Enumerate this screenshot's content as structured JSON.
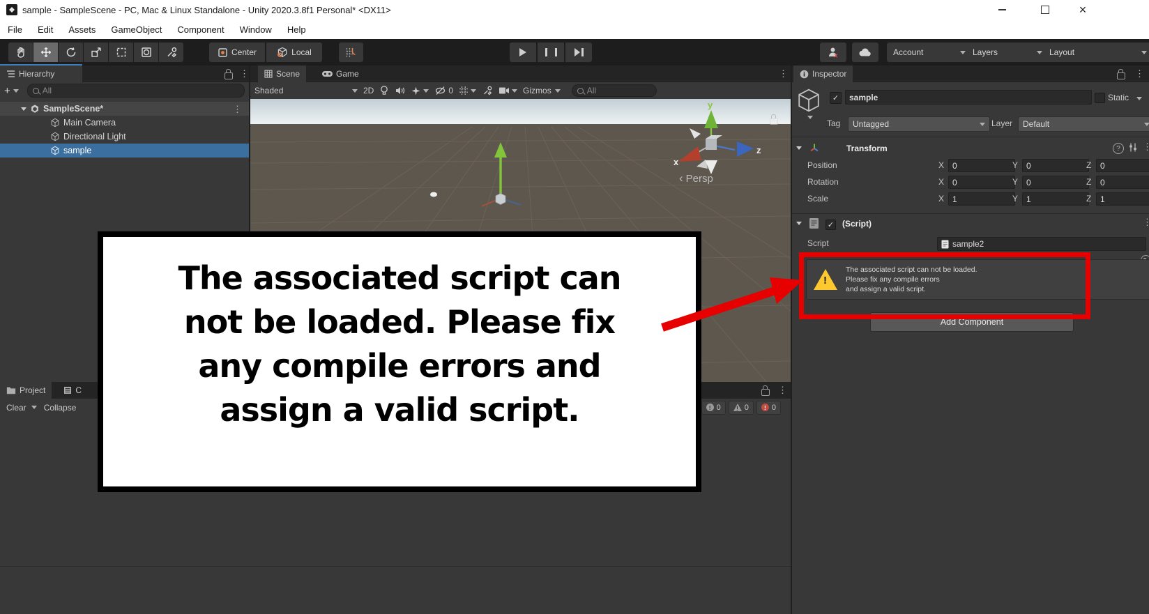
{
  "window": {
    "title": "sample - SampleScene - PC, Mac & Linux Standalone - Unity 2020.3.8f1 Personal* <DX11>"
  },
  "menu": {
    "items": [
      "File",
      "Edit",
      "Assets",
      "GameObject",
      "Component",
      "Window",
      "Help"
    ]
  },
  "toolbar": {
    "center": "Center",
    "local": "Local",
    "account": "Account",
    "layers": "Layers",
    "layout": "Layout"
  },
  "hierarchy": {
    "tab": "Hierarchy",
    "search_placeholder": "All",
    "scene_row": "SampleScene*",
    "children": [
      "Main Camera",
      "Directional Light",
      "sample"
    ]
  },
  "scene": {
    "tab_scene": "Scene",
    "tab_game": "Game",
    "shaded": "Shaded",
    "mode_2d": "2D",
    "hidden_count": "0",
    "gizmos": "Gizmos",
    "search_placeholder": "All",
    "persp": "Persp",
    "axes": {
      "x": "x",
      "y": "y",
      "z": "z"
    }
  },
  "inspector": {
    "tab": "Inspector",
    "object_name": "sample",
    "static_label": "Static",
    "tag_label": "Tag",
    "tag_value": "Untagged",
    "layer_label": "Layer",
    "layer_value": "Default",
    "transform": {
      "title": "Transform",
      "axis_x": "X",
      "axis_y": "Y",
      "axis_z": "Z",
      "rows": [
        {
          "label": "Position",
          "x": "0",
          "y": "0",
          "z": "0"
        },
        {
          "label": "Rotation",
          "x": "0",
          "y": "0",
          "z": "0"
        },
        {
          "label": "Scale",
          "x": "1",
          "y": "1",
          "z": "1"
        }
      ]
    },
    "script": {
      "title": "(Script)",
      "field_label": "Script",
      "field_value": "sample2",
      "warning": [
        "The associated script can not be loaded.",
        "Please fix any compile errors",
        "and assign a valid script."
      ]
    },
    "add_component": "Add Component"
  },
  "console": {
    "tab_project": "Project",
    "tab_console": "C",
    "clear": "Clear",
    "collapse": "Collapse",
    "counts": {
      "messages": "0",
      "warnings": "0",
      "errors": "0"
    }
  },
  "annotation": {
    "lines": [
      "The associated script can",
      "not be loaded. Please fix",
      "any compile errors and",
      "assign a valid script."
    ],
    "accent_color": "#e60000"
  },
  "icons": {
    "kebab": "⋮",
    "check": "✓",
    "close": "×",
    "persp_arrow": "‹",
    "plus": "+",
    "help": "?",
    "exclamation": "!"
  },
  "colors": {
    "selection": "#3a6fa0",
    "panel": "#383838",
    "tabbar": "#242424",
    "warning_yellow": "#fec92f",
    "annotation_red": "#e60000"
  }
}
